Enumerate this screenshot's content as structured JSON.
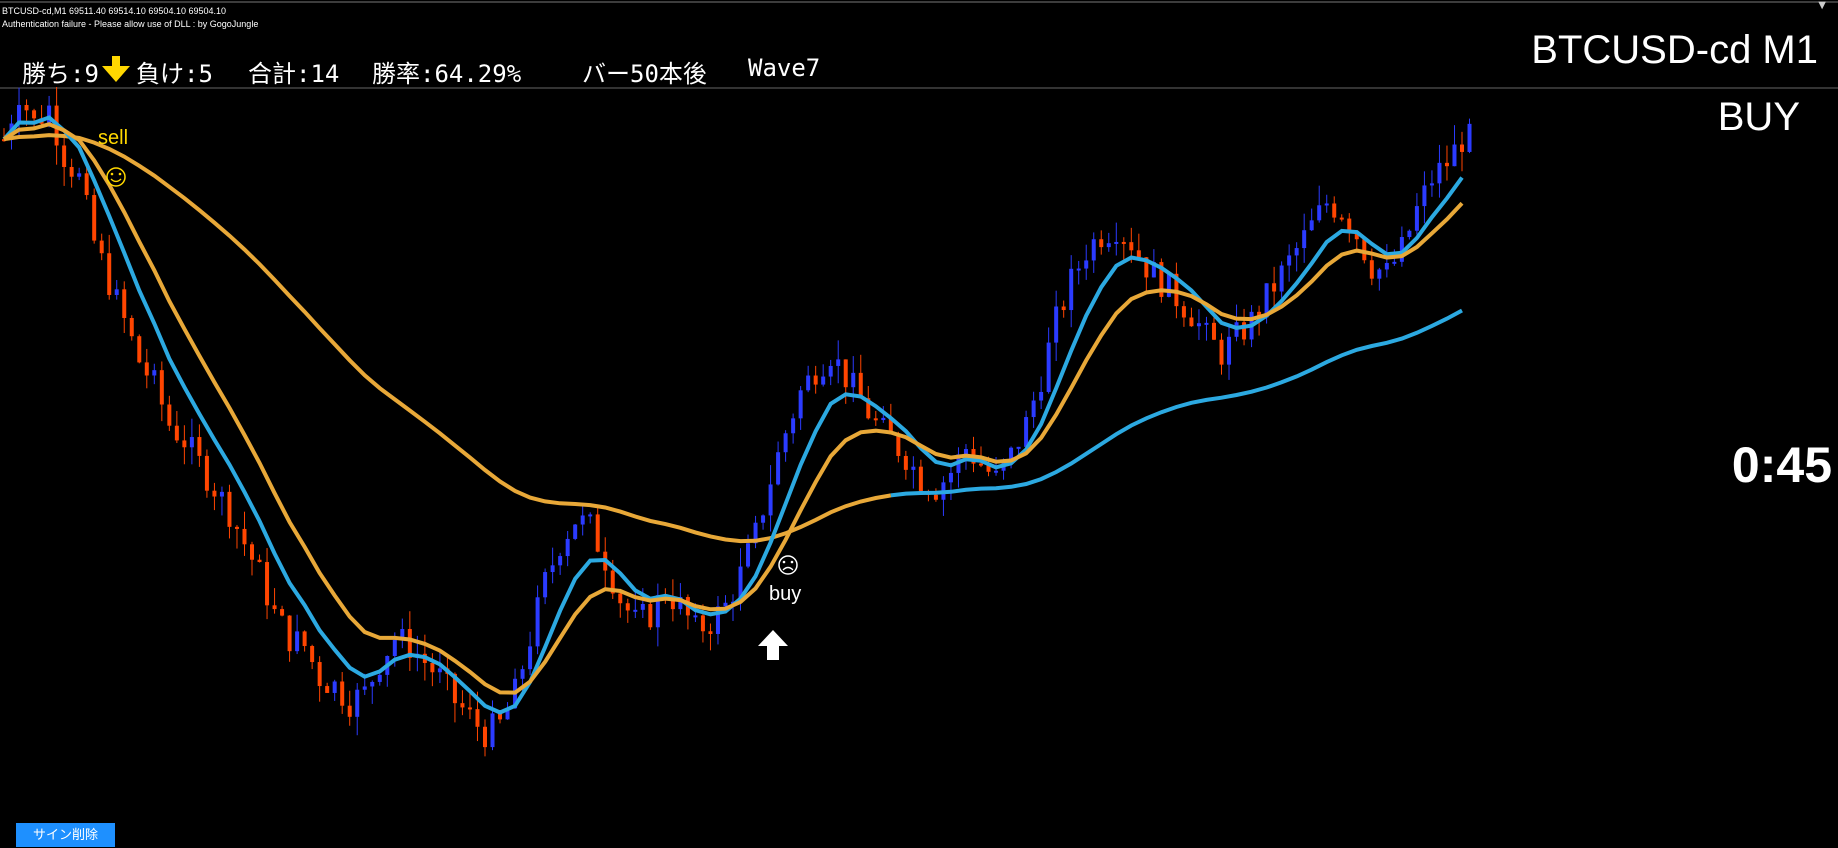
{
  "header": {
    "line1": "BTCUSD-cd,M1  69511.40 69514.10 69504.10 69504.10",
    "line2": "Authentication failure - Please allow use of DLL : by GogoJungle"
  },
  "stats": {
    "wins": "勝ち:9",
    "losses": "負け:5",
    "total": "合計:14",
    "win_rate": "勝率:64.29%",
    "bars_after": "バー50本後",
    "wave": "Wave7"
  },
  "symbol_title": "BTCUSD-cd M1",
  "signal_text": "BUY",
  "timer": "0:45",
  "signals": {
    "sell_label": "sell",
    "buy_label": "buy",
    "sell_face": "☺",
    "buy_face": "☹"
  },
  "buttons": {
    "delete_signs": "サイン削除"
  },
  "colors": {
    "background": "#000000",
    "bull_candle": "#2b3bff",
    "bear_candle": "#ff4500",
    "fast_ma": "#2ca9e1",
    "slow_ma": "#e8a838",
    "sell_arrow": "#ffd700",
    "buy_arrow": "#ffffff",
    "button": "#1e90ff"
  },
  "chart_data": {
    "type": "candlestick",
    "symbol": "BTCUSD-cd",
    "timeframe": "M1",
    "close_series_estimate": [
      69560,
      69620,
      69580,
      69600,
      69540,
      69510,
      69430,
      69380,
      69330,
      69280,
      69250,
      69200,
      69180,
      69150,
      69120,
      69090,
      69050,
      69010,
      68960,
      68930,
      68920,
      68880,
      68870,
      68850,
      68860,
      68900,
      68930,
      68920,
      68900,
      68880,
      68850,
      68830,
      68810,
      68820,
      68860,
      68930,
      69000,
      69050,
      69080,
      69070,
      69030,
      68980,
      68950,
      68960,
      68990,
      68970,
      68940,
      68950,
      68970,
      69010,
      69060,
      69130,
      69190,
      69240,
      69270,
      69290,
      69260,
      69230,
      69200,
      69180,
      69160,
      69130,
      69120,
      69140,
      69170,
      69150,
      69130,
      69160,
      69200,
      69260,
      69330,
      69380,
      69420,
      69440,
      69450,
      69430,
      69400,
      69380,
      69360,
      69340,
      69310,
      69290,
      69310,
      69330,
      69360,
      69390,
      69420,
      69450,
      69480,
      69470,
      69440,
      69400,
      69390,
      69420,
      69470,
      69510,
      69530,
      69560
    ],
    "fast_ma": "blue smoothed MA",
    "slow_ma": "orange smoothed MA",
    "long_ma": "blue long-period MA"
  }
}
